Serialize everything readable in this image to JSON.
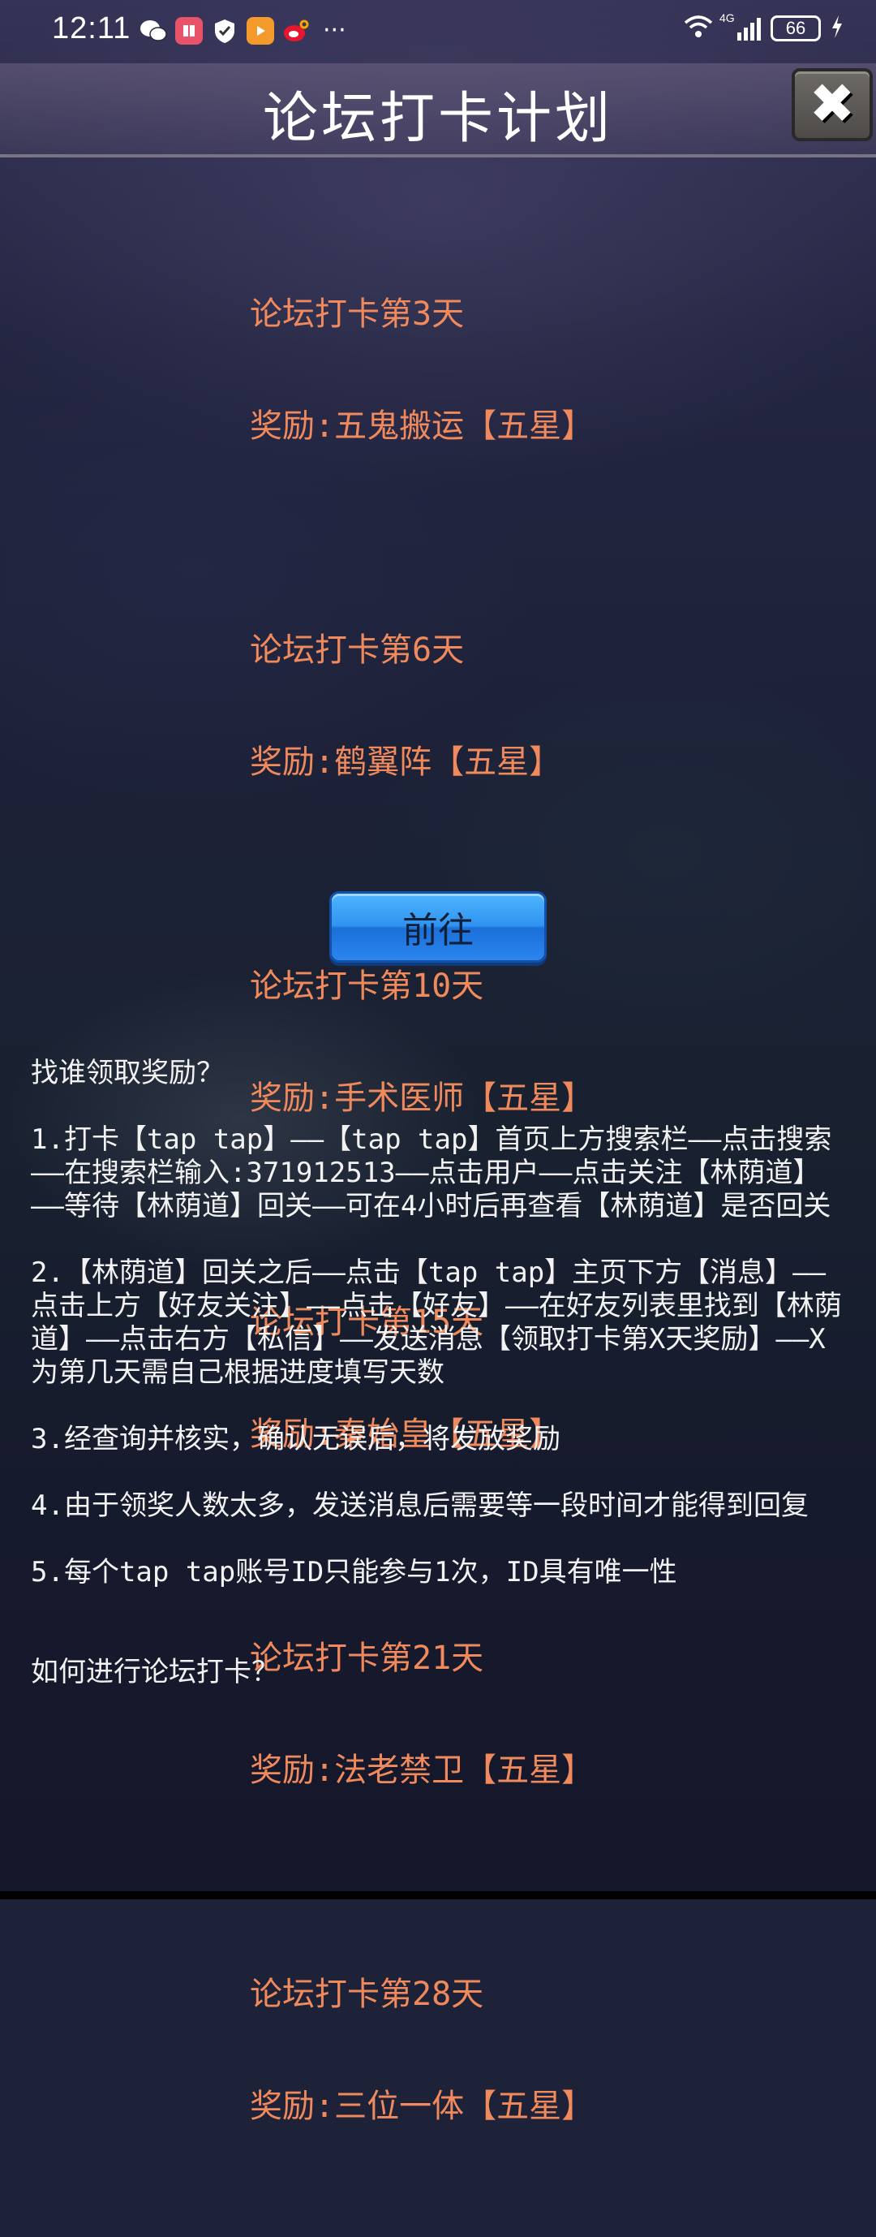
{
  "status_bar": {
    "time": "12:11",
    "network": "4G",
    "battery": "66",
    "more": "···"
  },
  "header": {
    "title": "论坛打卡计划",
    "close_symbol": "✖"
  },
  "rewards": [
    {
      "day_label": "论坛打卡第3天",
      "reward_label": "奖励:五鬼搬运【五星】"
    },
    {
      "day_label": "论坛打卡第6天",
      "reward_label": "奖励:鹤翼阵【五星】"
    },
    {
      "day_label": "论坛打卡第10天",
      "reward_label": "奖励:手术医师【五星】"
    },
    {
      "day_label": "论坛打卡第15天",
      "reward_label": "奖励:秦始皇【五星】"
    },
    {
      "day_label": "论坛打卡第21天",
      "reward_label": "奖励:法老禁卫【五星】"
    },
    {
      "day_label": "论坛打卡第28天",
      "reward_label": "奖励:三位一体【五星】"
    }
  ],
  "go_button": "前往",
  "instructions": {
    "question1": "找谁领取奖励？",
    "steps": [
      "1.打卡【tap tap】——【tap tap】首页上方搜索栏——点击搜索——在搜索栏输入:371912513——点击用户——点击关注【林荫道】——等待【林荫道】回关——可在4小时后再查看【林荫道】是否回关",
      "2.【林荫道】回关之后——点击【tap tap】主页下方【消息】——点击上方【好友关注】——点击【好友】——在好友列表里找到【林荫道】——点击右方【私信】——发送消息【领取打卡第X天奖励】——X为第几天需自己根据进度填写天数",
      "3.经查询并核实，确认无误后，将发放奖励",
      "4.由于领奖人数太多，发送消息后需要等一段时间才能得到回复",
      "5.每个tap tap账号ID只能参与1次，ID具有唯一性"
    ],
    "question2": "如何进行论坛打卡？"
  },
  "colors": {
    "reward_text": "#f08a5c",
    "button_blue": "#2f93f0",
    "body_text": "#f2f2f2"
  }
}
